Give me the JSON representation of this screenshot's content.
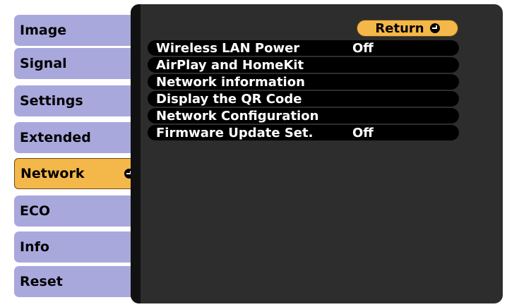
{
  "sidebar": {
    "tabs": [
      {
        "label": "Image"
      },
      {
        "label": "Signal"
      },
      {
        "label": "Settings"
      },
      {
        "label": "Extended"
      },
      {
        "label": "Network",
        "active": true
      },
      {
        "label": "ECO"
      },
      {
        "label": "Info"
      },
      {
        "label": "Reset"
      }
    ]
  },
  "panel": {
    "return_label": "Return",
    "items": [
      {
        "label": "Wireless LAN Power",
        "value": "Off"
      },
      {
        "label": "AirPlay and HomeKit",
        "value": ""
      },
      {
        "label": "Network information",
        "value": ""
      },
      {
        "label": "Display the QR Code",
        "value": ""
      },
      {
        "label": "Network Configuration",
        "value": ""
      },
      {
        "label": "Firmware Update Set.",
        "value": "Off"
      }
    ]
  },
  "colors": {
    "tab_bg": "#a9a8dd",
    "tab_active_bg": "#f4b84a",
    "panel_bg": "#2d2d2d",
    "item_bg": "#000000"
  },
  "icons": {
    "enter": "enter-icon"
  }
}
